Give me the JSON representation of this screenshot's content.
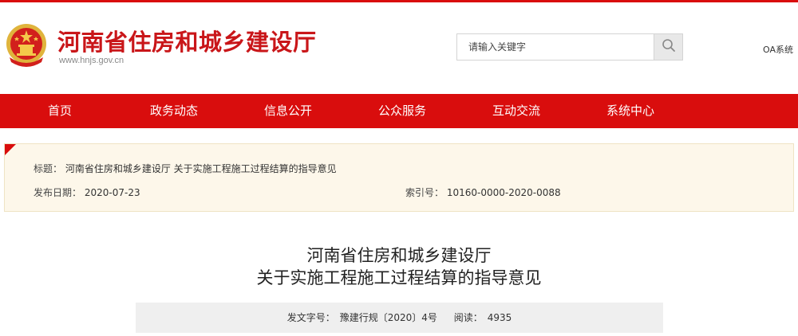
{
  "header": {
    "site_title": "河南省住房和城乡建设厅",
    "site_url": "www.hnjs.gov.cn",
    "emblem_icon": "national-emblem-icon",
    "search": {
      "placeholder": "请输入关键字",
      "icon": "search-icon"
    },
    "oa_link": "OA系统"
  },
  "nav": {
    "items": [
      {
        "label": "首页"
      },
      {
        "label": "政务动态"
      },
      {
        "label": "信息公开"
      },
      {
        "label": "公众服务"
      },
      {
        "label": "互动交流"
      },
      {
        "label": "系统中心"
      }
    ]
  },
  "info_panel": {
    "title_label": "标题：",
    "title_value": "河南省住房和城乡建设厅 关于实施工程施工过程结算的指导意见",
    "date_label": "发布日期：",
    "date_value": "2020-07-23",
    "index_label": "索引号：",
    "index_value": "10160-0000-2020-0088"
  },
  "article": {
    "title_line1": "河南省住房和城乡建设厅",
    "title_line2": "关于实施工程施工过程结算的指导意见",
    "doc_no_label": "发文字号：",
    "doc_no_value": "豫建行规〔2020〕4号",
    "reads_label": "阅读：",
    "reads_value": "4935"
  },
  "colors": {
    "brand_red": "#d90d0d",
    "title_red": "#c91619",
    "panel_bg": "#fdf7ea",
    "meta_bg": "#efefef"
  }
}
